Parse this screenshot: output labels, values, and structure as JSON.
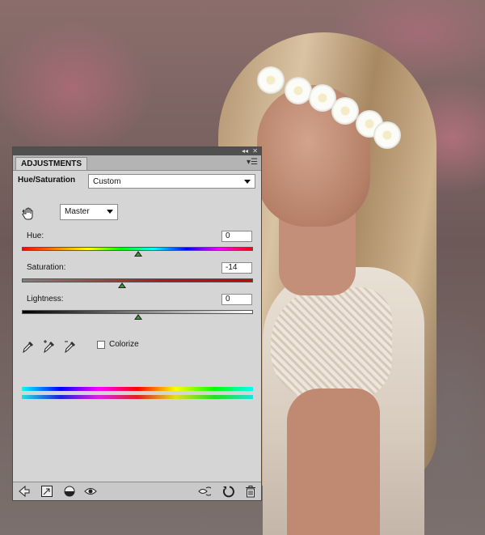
{
  "panel": {
    "tab_label": "ADJUSTMENTS",
    "adjustment_name": "Hue/Saturation",
    "preset": {
      "selected": "Custom"
    },
    "channel": {
      "selected": "Master"
    },
    "sliders": [
      {
        "label": "Hue:",
        "value": "0"
      },
      {
        "label": "Saturation:",
        "value": "-14"
      },
      {
        "label": "Lightness:",
        "value": "0"
      }
    ],
    "colorize_label": "Colorize",
    "colorize_checked": false
  },
  "icons": {
    "topbar": [
      "collapse-icon",
      "close-icon"
    ],
    "panel_menu": "panel-menu-icon",
    "targeted_adjust": "targeted-adjustment-hand-icon",
    "eyedroppers": [
      "eyedropper-icon",
      "eyedropper-add-icon",
      "eyedropper-subtract-icon"
    ],
    "bottom_left": [
      "return-to-list-icon",
      "expanded-view-icon",
      "clip-to-layer-icon",
      "visibility-eye-icon"
    ],
    "bottom_right": [
      "view-previous-state-icon",
      "reset-icon",
      "delete-adjustment-icon"
    ]
  },
  "colors": {
    "panel_bg": "#d5d5d5",
    "topbar_bg": "#505050",
    "thumb_accent": "#3a9a3a"
  }
}
